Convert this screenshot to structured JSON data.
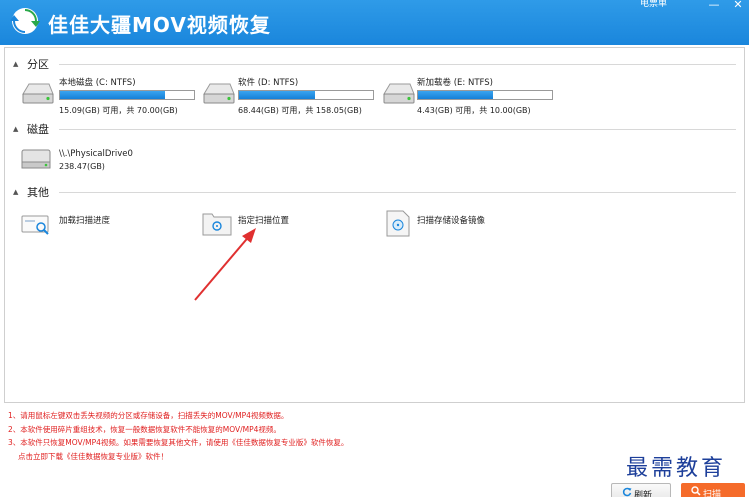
{
  "app": {
    "title": "佳佳大疆MOV视频恢复",
    "extra": "电票单",
    "minimize": "—",
    "close": "✕"
  },
  "sections": {
    "partitions": {
      "title": "分区"
    },
    "disks": {
      "title": "磁盘"
    },
    "other": {
      "title": "其他"
    }
  },
  "partitions": [
    {
      "name": "本地磁盘 (C: NTFS)",
      "size": "15.09(GB) 可用，共 70.00(GB)",
      "used_fraction": 0.78
    },
    {
      "name": "软件 (D: NTFS)",
      "size": "68.44(GB) 可用，共 158.05(GB)",
      "used_fraction": 0.57
    },
    {
      "name": "新加载卷 (E: NTFS)",
      "size": "4.43(GB) 可用，共 10.00(GB)",
      "used_fraction": 0.56
    }
  ],
  "disks": [
    {
      "name": "\\\\.\\PhysicalDrive0",
      "size": "238.47(GB)"
    }
  ],
  "others": [
    {
      "label": "加载扫描进度",
      "icon": "load-scan-progress-icon"
    },
    {
      "label": "指定扫描位置",
      "icon": "specify-scan-location-icon"
    },
    {
      "label": "扫描存储设备镜像",
      "icon": "scan-device-image-icon"
    }
  ],
  "notes": [
    "1、请用鼠标左键双击丢失视频的分区或存储设备，扫描丢失的MOV/MP4视频数据。",
    "2、本软件使用碎片重组技术，恢复一般数据恢复软件不能恢复的MOV/MP4视频。",
    "3、本软件只恢复MOV/MP4视频。如果需要恢复其他文件，请使用《佳佳数据恢复专业版》软件恢复。",
    "点击立即下载《佳佳数据恢复专业版》软件！"
  ],
  "buttons": {
    "refresh": "刷新",
    "scan": "扫描"
  },
  "watermark": "最需教育",
  "colors": {
    "titlebar": "#1a86dc",
    "bar_fill": "#1a8ae0",
    "note_text": "#e02020",
    "scan_button": "#f56b2a",
    "arrow": "#e03030"
  }
}
